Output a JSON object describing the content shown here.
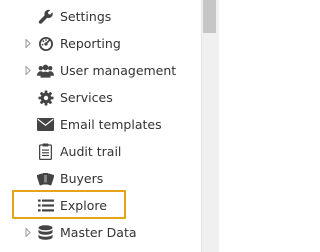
{
  "sidebar": {
    "items": [
      {
        "label": "Settings",
        "icon": "wrench-icon",
        "expandable": false
      },
      {
        "label": "Reporting",
        "icon": "reporting-icon",
        "expandable": true
      },
      {
        "label": "User management",
        "icon": "users-icon",
        "expandable": true
      },
      {
        "label": "Services",
        "icon": "gear-icon",
        "expandable": false
      },
      {
        "label": "Email templates",
        "icon": "envelope-icon",
        "expandable": false
      },
      {
        "label": "Audit trail",
        "icon": "clipboard-icon",
        "expandable": false
      },
      {
        "label": "Buyers",
        "icon": "cards-icon",
        "expandable": false
      },
      {
        "label": "Explore",
        "icon": "list-icon",
        "expandable": false,
        "highlighted": true
      },
      {
        "label": "Master Data",
        "icon": "database-icon",
        "expandable": true
      }
    ]
  },
  "colors": {
    "highlight_border": "#e8a317",
    "text": "#333333",
    "icon": "#444444",
    "expander": "#9a9a9a"
  }
}
